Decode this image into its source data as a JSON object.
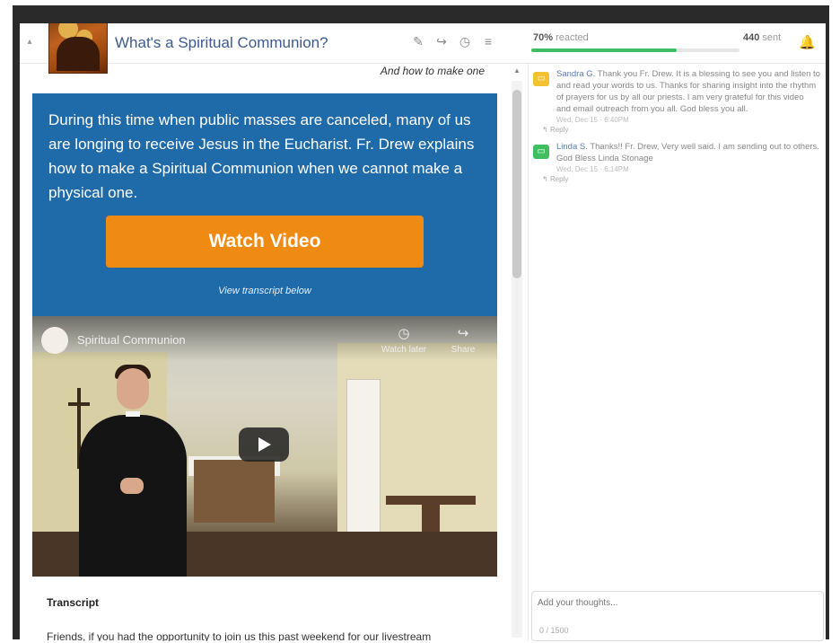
{
  "header": {
    "title": "What's a Spiritual Communion?",
    "reacted_value": "70%",
    "reacted_label": "reacted",
    "reacted_progress": 0.7,
    "sent_value": "440",
    "sent_label": "sent"
  },
  "content": {
    "subtitle": "And how to make one",
    "banner_text": "During this time when public masses are canceled, many of us are longing to receive Jesus in the Eucharist. Fr. Drew explains how to make a Spiritual Communion when we cannot make a physical one.",
    "watch_button": "Watch Video",
    "transcript_link": "View transcript below",
    "video": {
      "title": "Spiritual Communion",
      "watch_later": "Watch later",
      "share": "Share"
    },
    "transcript_heading": "Transcript",
    "transcript_first_line": "Friends, if you had the opportunity to join us this past weekend for our livestream"
  },
  "comments": [
    {
      "author": "Sandra G.",
      "text": "Thank you Fr. Drew. It is a blessing to see you and listen to and read your words to us. Thanks for sharing insight into the rhythm of prayers for us by all our priests. I am very grateful for this video and email outreach from you all. God bless you all.",
      "date": "Wed, Dec 15 · 6:40PM",
      "reply": "Reply",
      "color": "#f2c230"
    },
    {
      "author": "Linda S.",
      "text": "Thanks!! Fr. Drew, Very well said. I am sending out to others. God Bless Linda Stonage",
      "date": "Wed, Dec 15 · 6:14PM",
      "reply": "Reply",
      "color": "#3fbf5f"
    }
  ],
  "compose": {
    "placeholder": "Add your thoughts...",
    "footer": "0 / 1500"
  },
  "colors": {
    "accent": "#1f6aa8",
    "button": "#ef8a13",
    "progress": "#3fbf5f",
    "bell": "#9b2bb5"
  }
}
